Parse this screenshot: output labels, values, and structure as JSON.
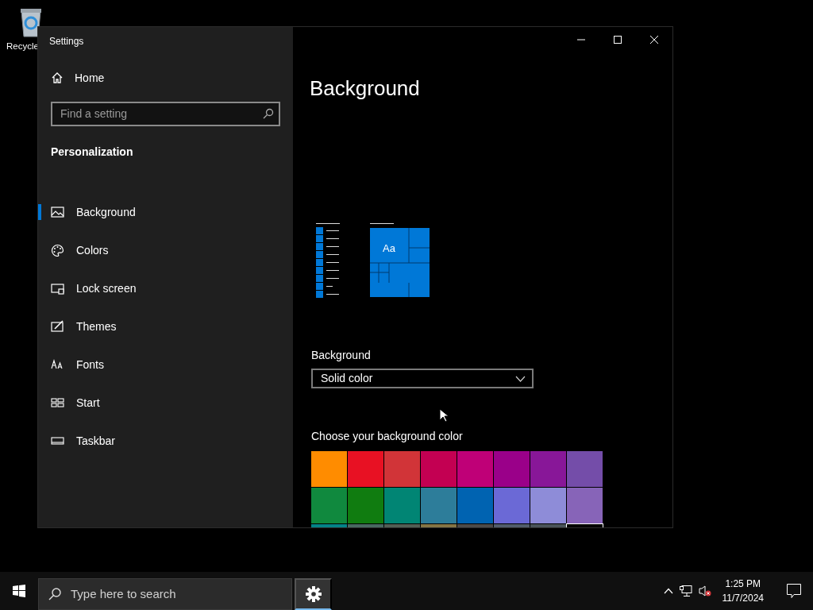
{
  "desktop_icons": [
    {
      "label": "Recycle"
    }
  ],
  "window": {
    "title": "Settings"
  },
  "sidebar": {
    "home": "Home",
    "search": {
      "placeholder": "Find a setting"
    },
    "section": "Personalization",
    "items": [
      {
        "label": "Background",
        "kind": "picture",
        "selected": true
      },
      {
        "label": "Colors",
        "kind": "palette",
        "selected": false
      },
      {
        "label": "Lock screen",
        "kind": "lock",
        "selected": false
      },
      {
        "label": "Themes",
        "kind": "brush",
        "selected": false
      },
      {
        "label": "Fonts",
        "kind": "font",
        "selected": false
      },
      {
        "label": "Start",
        "kind": "start",
        "selected": false
      },
      {
        "label": "Taskbar",
        "kind": "taskbar",
        "selected": false
      }
    ]
  },
  "content": {
    "title": "Background",
    "preview_text": "Aa",
    "background_label": "Background",
    "background_value": "Solid color",
    "color_label": "Choose your background color",
    "swatches": [
      {
        "color": "#ff8c00",
        "selected": false
      },
      {
        "color": "#e81123",
        "selected": false
      },
      {
        "color": "#d13438",
        "selected": false
      },
      {
        "color": "#c30052",
        "selected": false
      },
      {
        "color": "#bf0077",
        "selected": false
      },
      {
        "color": "#9a0089",
        "selected": false
      },
      {
        "color": "#881798",
        "selected": false
      },
      {
        "color": "#744da9",
        "selected": false
      },
      {
        "color": "#10893e",
        "selected": false
      },
      {
        "color": "#107c10",
        "selected": false
      },
      {
        "color": "#018574",
        "selected": false
      },
      {
        "color": "#2d7d9a",
        "selected": false
      },
      {
        "color": "#0063b1",
        "selected": false
      },
      {
        "color": "#6b69d6",
        "selected": false
      },
      {
        "color": "#8e8cd8",
        "selected": false
      },
      {
        "color": "#8764b8",
        "selected": false
      },
      {
        "color": "#038387",
        "selected": false
      },
      {
        "color": "#486860",
        "selected": false
      },
      {
        "color": "#525e54",
        "selected": false
      },
      {
        "color": "#847545",
        "selected": false
      },
      {
        "color": "#4c4a48",
        "selected": false
      },
      {
        "color": "#515c6b",
        "selected": false
      },
      {
        "color": "#4a5459",
        "selected": false
      },
      {
        "color": "#000000",
        "selected": true
      }
    ]
  },
  "taskbar": {
    "search": {
      "placeholder": "Type here to search"
    },
    "apps": [
      {
        "kind": "settings",
        "active": true
      }
    ],
    "clock": {
      "time": "1:25 PM",
      "date": "11/7/2024"
    }
  }
}
